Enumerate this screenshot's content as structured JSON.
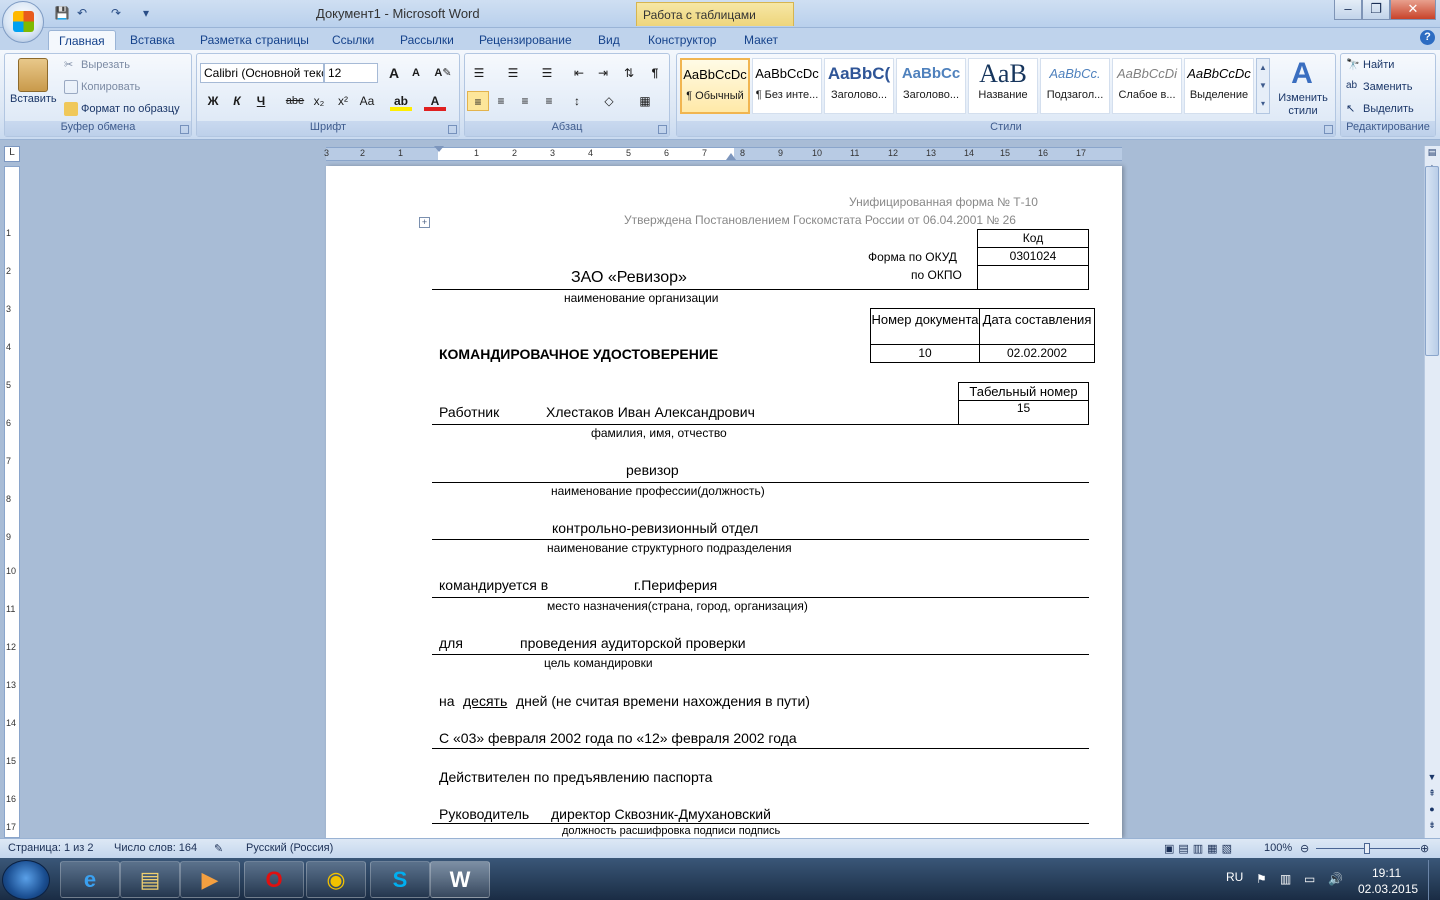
{
  "titlebar": {
    "title": "Документ1 - Microsoft Word",
    "context_tab": "Работа с таблицами",
    "min": "–",
    "max": "❐",
    "close": "✕"
  },
  "tabs": [
    "Главная",
    "Вставка",
    "Разметка страницы",
    "Ссылки",
    "Рассылки",
    "Рецензирование",
    "Вид",
    "Конструктор",
    "Макет"
  ],
  "clipboard": {
    "paste": "Вставить",
    "cut": "Вырезать",
    "copy": "Копировать",
    "format_painter": "Формат по образцу",
    "label": "Буфер обмена"
  },
  "font": {
    "name": "Calibri (Основной текст)",
    "size": "12",
    "label": "Шрифт",
    "bold": "Ж",
    "italic": "К",
    "underline": "Ч",
    "strike": "abe",
    "sub": "x₂",
    "sup": "x²",
    "case": "Aa",
    "grow": "A",
    "shrink": "A"
  },
  "paragraph": {
    "label": "Абзац"
  },
  "styles": {
    "label": "Стили",
    "change": "Изменить стили",
    "items": [
      {
        "preview": "AaBbCcDc",
        "name": "¶ Обычный"
      },
      {
        "preview": "AaBbCcDc",
        "name": "¶ Без инте..."
      },
      {
        "preview": "AaBbC(",
        "name": "Заголово..."
      },
      {
        "preview": "AaBbCc",
        "name": "Заголово..."
      },
      {
        "preview": "AaB",
        "name": "Название"
      },
      {
        "preview": "AaBbCc.",
        "name": "Подзагол..."
      },
      {
        "preview": "AaBbCcDi",
        "name": "Слабое в..."
      },
      {
        "preview": "AaBbCcDc",
        "name": "Выделение"
      }
    ]
  },
  "editing": {
    "find": "Найти",
    "replace": "Заменить",
    "select": "Выделить",
    "label": "Редактирование"
  },
  "ruler": {
    "corner": "L",
    "h_labels": [
      "3",
      "2",
      "1",
      "1",
      "2",
      "3",
      "4",
      "5",
      "6",
      "7",
      "8",
      "9",
      "10",
      "11",
      "12",
      "13",
      "14",
      "15",
      "16",
      "17"
    ],
    "v_labels": [
      "1",
      "2",
      "3",
      "4",
      "5",
      "6",
      "7",
      "8",
      "9",
      "10",
      "11",
      "12",
      "13",
      "14",
      "15",
      "16",
      "17"
    ]
  },
  "document": {
    "form_no": "Унифицированная форма № Т-10",
    "approved": "Утверждена Постановлением Госкомстата России от 06.04.2001  № 26",
    "code_header": "Код",
    "okud_label": "Форма по ОКУД",
    "okud_value": "0301024",
    "okpo_label": "по ОКПО",
    "org_name": "ЗАО «Ревизор»",
    "org_caption": "наименование организации",
    "docnum_header": "Номер документа",
    "date_header": "Дата составления",
    "docnum": "10",
    "docdate": "02.02.2002",
    "heading": "КОМАНДИРОВАЧНОЕ УДОСТОВЕРЕНИЕ",
    "tabnum_header": "Табельный номер",
    "tabnum": "15",
    "worker_label": "Работник",
    "worker_name": "Хлестаков  Иван Александрович",
    "name_caption": "фамилия, имя, отчество",
    "position": "ревизор",
    "position_caption": "наименование профессии(должность)",
    "dept": "контрольно-ревизионный  отдел",
    "dept_caption": "наименование структурного подразделения",
    "sent_label": "командируется в",
    "destination": "г.Периферия",
    "dest_caption": "место назначения(страна, город, организация)",
    "purpose_label": "для",
    "purpose": "проведения  аудиторской проверки",
    "purpose_caption": "цель командировки",
    "days_prefix": "на",
    "days_value": "десять",
    "days_suffix": "дней (не считая времени нахождения в пути)",
    "period": "С «03» февраля 2002  года по «12» февраля 2002  года",
    "valid": "Действителен по предъявлению паспорта",
    "head_label": "Руководитель",
    "head_value": "директор  Сквозник-Дмухановский",
    "sign_caption": "должность     расшифровка  подписи     подпись"
  },
  "status": {
    "page": "Страница: 1 из 2",
    "words": "Число слов: 164",
    "lang": "Русский (Россия)",
    "zoom": "100%"
  },
  "taskbar": {
    "lang": "RU",
    "time": "19:11",
    "date": "02.03.2015"
  }
}
